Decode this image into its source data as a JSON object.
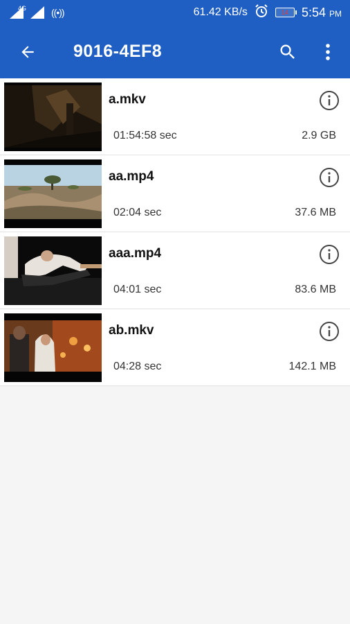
{
  "status_bar": {
    "network_type": "4G",
    "speed": "61.42 KB/s",
    "battery_level": "14",
    "time": "5:54",
    "ampm": "PM"
  },
  "app_bar": {
    "title": "9016-4EF8"
  },
  "files": [
    {
      "name": "a.mkv",
      "duration": "01:54:58 sec",
      "size": "2.9 GB"
    },
    {
      "name": "aa.mp4",
      "duration": "02:04 sec",
      "size": "37.6 MB"
    },
    {
      "name": "aaa.mp4",
      "duration": "04:01 sec",
      "size": "83.6 MB"
    },
    {
      "name": "ab.mkv",
      "duration": "04:28 sec",
      "size": "142.1 MB"
    }
  ],
  "colors": {
    "primary": "#1f5ec2",
    "background": "#f5f5f5",
    "battery_low": "#e53935"
  }
}
